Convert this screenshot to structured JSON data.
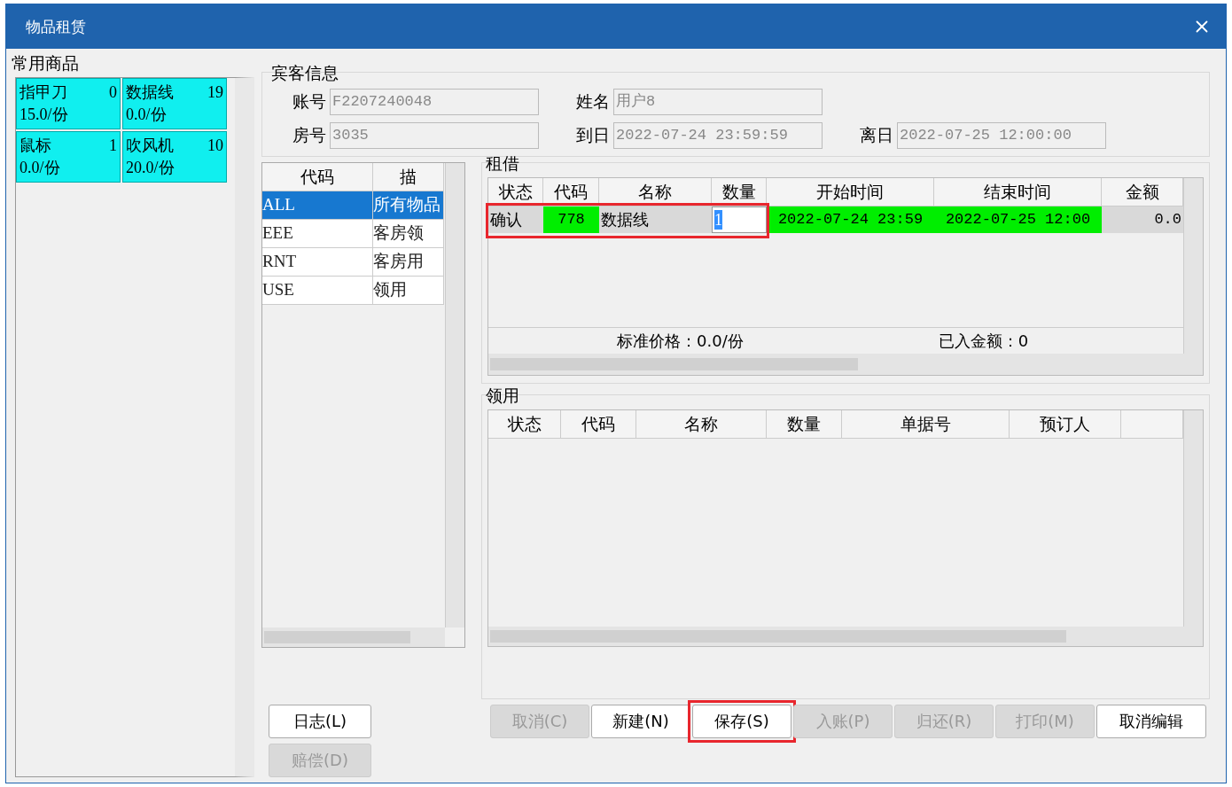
{
  "window": {
    "title": "物品租赁"
  },
  "favorites": {
    "title": "常用商品",
    "items": [
      {
        "name": "指甲刀",
        "count": "0",
        "price": "15.0/份"
      },
      {
        "name": "数据线",
        "count": "19",
        "price": "0.0/份"
      },
      {
        "name": "鼠标",
        "count": "1",
        "price": "0.0/份"
      },
      {
        "name": "吹风机",
        "count": "10",
        "price": "20.0/份"
      }
    ]
  },
  "guest_info": {
    "title": "宾客信息",
    "rows": [
      [
        {
          "label": "账号",
          "value": "F2207240048"
        },
        {
          "label": "姓名",
          "value": "用户8"
        }
      ],
      [
        {
          "label": "房号",
          "value": "3035"
        },
        {
          "label": "到日",
          "value": "2022-07-24 23:59:59"
        },
        {
          "label": "离日",
          "value": "2022-07-25 12:00:00"
        }
      ]
    ]
  },
  "categories": {
    "columns": [
      "代码",
      "描"
    ],
    "rows": [
      {
        "code": "ALL",
        "description": "所有物品",
        "selected": true
      },
      {
        "code": "EEE",
        "description": "客房领",
        "selected": false
      },
      {
        "code": "RNT",
        "description": "客房用",
        "selected": false
      },
      {
        "code": "USE",
        "description": "领用",
        "selected": false
      }
    ]
  },
  "rental": {
    "title": "租借",
    "columns": [
      "状态",
      "代码",
      "名称",
      "数量",
      "开始时间",
      "结束时间",
      "金额"
    ],
    "rows": [
      {
        "status": "确认",
        "code": "778",
        "name": "数据线",
        "quantity": "1",
        "start": "2022-07-24 23:59",
        "end": "2022-07-25 12:00",
        "amount": "0.0",
        "editing": true,
        "annotated": true
      }
    ],
    "standard_price": "标准价格：0.0/份",
    "paid": "已入金额：0"
  },
  "usage": {
    "title": "领用",
    "columns": [
      "状态",
      "代码",
      "名称",
      "数量",
      "单据号",
      "预订人"
    ]
  },
  "side_buttons": [
    {
      "label": "日志(L)",
      "disabled": false
    },
    {
      "label": "赔偿(D)",
      "disabled": true
    }
  ],
  "buttons": [
    {
      "label": "取消(C)",
      "disabled": true,
      "annotated": false
    },
    {
      "label": "新建(N)",
      "disabled": false,
      "annotated": false
    },
    {
      "label": "保存(S)",
      "disabled": false,
      "annotated": true
    },
    {
      "label": "入账(P)",
      "disabled": true,
      "annotated": false
    },
    {
      "label": "归还(R)",
      "disabled": true,
      "annotated": false
    },
    {
      "label": "打印(M)",
      "disabled": true,
      "annotated": false
    },
    {
      "label": "取消编辑",
      "disabled": false,
      "annotated": false
    }
  ]
}
